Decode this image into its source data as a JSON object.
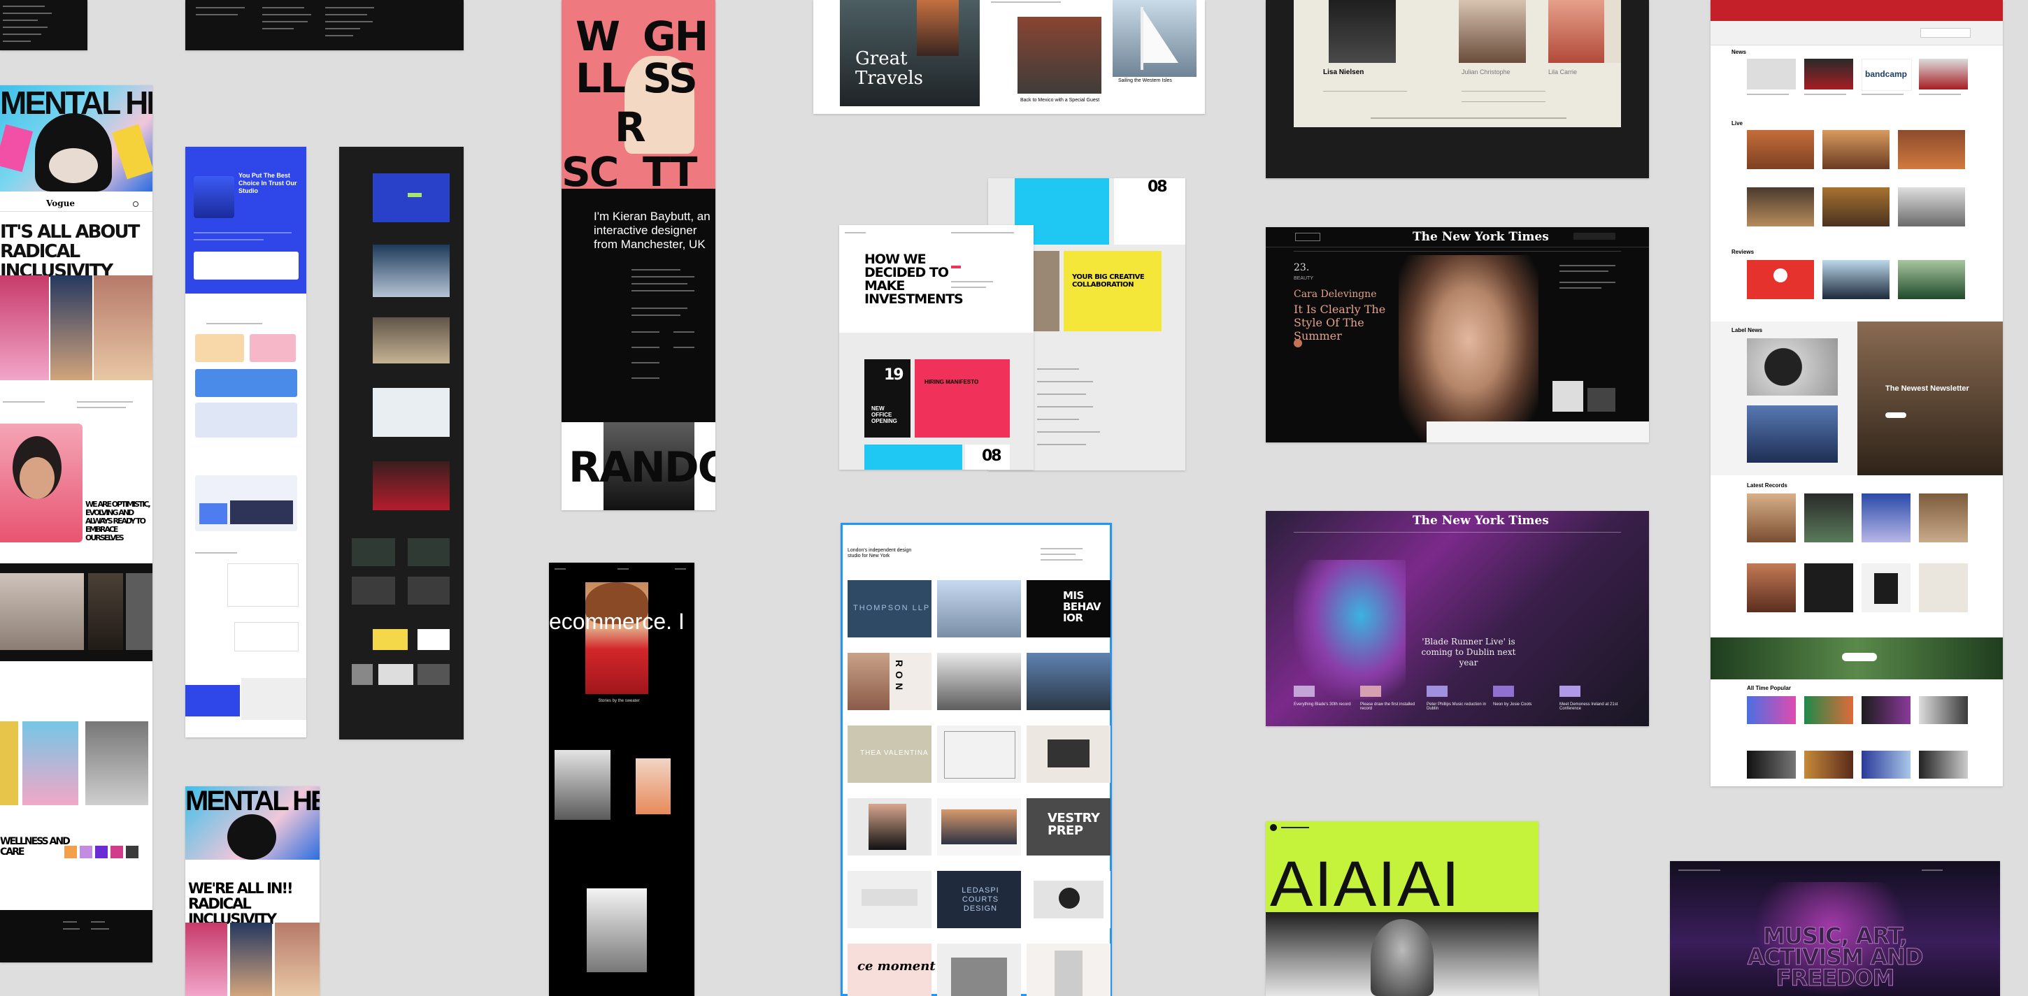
{
  "canvas": {
    "background": "#dedede"
  },
  "vogue_card": {
    "logo": "Vogue",
    "headline": "IT'S ALL ABOUT RADICAL INCLUSIVITY",
    "hero_word": "MENTAL HEALTH",
    "section_headline": "WE ARE OPTIMISTIC, EVOLVING AND ALWAYS READY TO EMBRACE OURSELVES",
    "wellness": "WELLNESS AND CARE",
    "accent": "#4fc3f7"
  },
  "vogue_mini": {
    "hero_word": "MENTAL HEALTH",
    "headline": "WE'RE ALL IN!! RADICAL INCLUSIVITY"
  },
  "blue_landing": {
    "headline": "You Put The Best Choice In Trust Our Studio",
    "accent": "#2f47e8"
  },
  "dark_portfolio": {
    "accent": "#2941c9"
  },
  "kieran": {
    "letters": [
      "W",
      "GH",
      "LL",
      "SS",
      "R",
      "SC",
      "TT"
    ],
    "intro": "I'm Kieran Baybutt, an interactive designer from Manchester, UK",
    "footer_word": "RANDOM",
    "accent": "#ee7a80"
  },
  "ecommerce": {
    "marquee": "ecommerce. I",
    "caption": "Stories by the sweater"
  },
  "travel": {
    "title": "Great Travels",
    "caption_a": "Back to Mexico with a Special Guest",
    "caption_b": "Sailing the Western Isles"
  },
  "investments": {
    "headline": "HOW WE DECIDED TO MAKE INVESTMENTS",
    "number_a": "19",
    "number_b": "08",
    "number_c": "08",
    "card_a": "NEW OFFICE OPENING",
    "card_b": "HIRING MANIFESTO",
    "card_c": "YOUR BIG CREATIVE COLLABORATION",
    "accent_cyan": "#1ec8f2",
    "accent_yellow": "#f5e63a",
    "accent_red": "#f0315a"
  },
  "studio_grid": {
    "intro": "London's independent design studio for New York",
    "tiles": [
      "THOMPSON LLP",
      "MIS BEHAV IOR",
      "RON",
      "THEA VALENTINA",
      "VESTRY PREP",
      "LEDASPI COURTS DESIGN",
      "ce moment"
    ],
    "accent": "#2196f3"
  },
  "magazine": {
    "author": "Lisa Nielsen",
    "names": [
      "Julian Christophe",
      "Lila Carrie"
    ]
  },
  "nyt_a": {
    "logo": "The New York Times",
    "date": "23.",
    "kicker": "Cara Delevingne",
    "headline": "It Is Clearly The Style Of The Summer",
    "section": "BEAUTY"
  },
  "nyt_b": {
    "logo": "The New York Times",
    "headline": "'Blade Runner Live' is coming to Dublin next year",
    "headlines": [
      "Everything Blade's 30th record",
      "Please draw the first installed record",
      "Peter Phillips Music reduction in Dublin",
      "Neon by Josie Coots",
      "Meet Demoness Ireland at 21st Conference"
    ]
  },
  "aiaiai": {
    "title": "AIAIAI",
    "accent": "#c5f23a"
  },
  "music_freedom": {
    "headline": "MUSIC, ART, ACTIVISM AND FREEDOM"
  },
  "bandcamp": {
    "sections": [
      "News",
      "Live",
      "Reviews",
      "Label News",
      "Latest Records",
      "All Time Popular"
    ],
    "logo": "bandcamp",
    "newsletter": "The Newest Newsletter",
    "accent": "#c3202a"
  }
}
